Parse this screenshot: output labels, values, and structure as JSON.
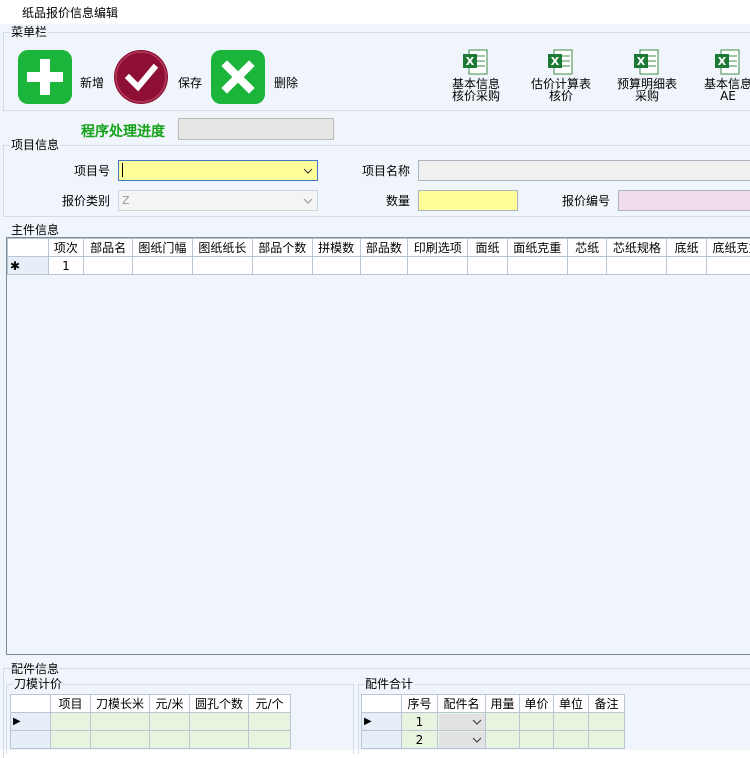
{
  "window": {
    "title": "纸品报价信息编辑"
  },
  "menu": {
    "title": "菜单栏",
    "buttons": {
      "add": "新增",
      "save": "保存",
      "delete": "删除"
    },
    "excel_buttons": [
      {
        "line1": "基本信息",
        "line2": "核价采购"
      },
      {
        "line1": "估价计算表",
        "line2": "核价"
      },
      {
        "line1": "预算明细表",
        "line2": "采购"
      },
      {
        "line1": "基本信息",
        "line2": "AE"
      }
    ]
  },
  "progress": {
    "label": "程序处理进度"
  },
  "project": {
    "title": "项目信息",
    "project_no_label": "项目号",
    "project_no_value": "",
    "project_name_label": "项目名称",
    "quote_type_label": "报价类别",
    "quote_type_value": "Z",
    "quantity_label": "数量",
    "quote_no_label": "报价编号"
  },
  "main_parts": {
    "title": "主件信息",
    "columns": [
      "项次",
      "部品名",
      "图纸门幅",
      "图纸纸长",
      "部品个数",
      "拼模数",
      "部品数",
      "印刷选项",
      "面纸",
      "面纸克重",
      "芯纸",
      "芯纸规格",
      "底纸",
      "底纸克重"
    ],
    "new_row_marker": "✱",
    "rows": [
      [
        "1"
      ]
    ]
  },
  "accessories": {
    "title": "配件信息",
    "die_cost": {
      "title": "刀模计价",
      "columns": [
        "项目",
        "刀模长米",
        "元/米",
        "圆孔个数",
        "元/个"
      ],
      "current_row_marker": "▶"
    },
    "summary": {
      "title": "配件合计",
      "columns": [
        "序号",
        "配件名",
        "用量",
        "单价",
        "单位",
        "备注"
      ],
      "current_row_marker": "▶",
      "rows": [
        [
          "1"
        ],
        [
          "2"
        ]
      ]
    }
  },
  "colors": {
    "accent_green": "#1cb53b",
    "save_maroon": "#8d0f33",
    "highlight_yellow": "#ffff99",
    "highlight_pink": "#f2dcec",
    "progress_green": "#16a21a"
  },
  "icons": {
    "add": "plus-icon",
    "save": "check-icon",
    "delete": "x-icon",
    "excel": "excel-icon",
    "dropdown": "chevron-down-icon"
  }
}
